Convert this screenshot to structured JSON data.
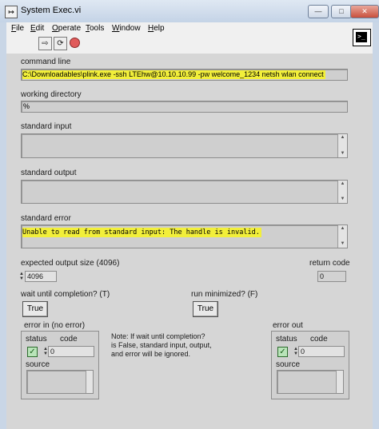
{
  "window": {
    "title": "System Exec.vi",
    "icon_glyph": "↦",
    "controls": [
      "minimize-icon",
      "maximize-icon",
      "close-icon"
    ]
  },
  "menu": {
    "items": [
      {
        "key": "F",
        "rest": "ile"
      },
      {
        "key": "E",
        "rest": "dit"
      },
      {
        "key": "O",
        "rest": "perate"
      },
      {
        "key": "T",
        "rest": "ools"
      },
      {
        "key": "W",
        "rest": "indow"
      },
      {
        "key": "H",
        "rest": "elp"
      }
    ]
  },
  "toolbar": {
    "buttons": [
      "run-arrow-icon",
      "run-continuously-icon",
      "abort-stop-icon"
    ],
    "stop_color": "#e05a5a"
  },
  "vi_icon": {
    "glyph": ">_"
  },
  "fields": {
    "command_line": {
      "label": "command line",
      "value": "C:\\Downloadables\\plink.exe -ssh LTEhw@10.10.10.99 -pw welcome_1234 netsh wlan connect"
    },
    "working_directory": {
      "label": "working directory",
      "value": "%"
    },
    "standard_input": {
      "label": "standard input",
      "value": ""
    },
    "standard_output": {
      "label": "standard output",
      "value": ""
    },
    "standard_error": {
      "label": "standard error",
      "value": "Unable to read from standard input: The handle is invalid."
    },
    "expected_output_size": {
      "label": "expected output size  (4096)",
      "value": "4096"
    },
    "return_code": {
      "label": "return code",
      "value": "0"
    },
    "wait_until_completion": {
      "label": "wait until completion? (T)",
      "value": "True"
    },
    "run_minimized": {
      "label": "run minimized? (F)",
      "value": "True"
    }
  },
  "error_in": {
    "title": "error in (no error)",
    "status_label": "status",
    "code_label": "code",
    "code_value": "0",
    "status_checked": true,
    "source_label": "source"
  },
  "error_out": {
    "title": "error out",
    "status_label": "status",
    "code_label": "code",
    "code_value": "0",
    "status_checked": true,
    "source_label": "source"
  },
  "note": {
    "lines": [
      "Note:  If wait until completion?",
      "is False, standard input, output,",
      "and error will be ignored."
    ]
  },
  "colors": {
    "highlight": "#f2ef3a",
    "panel": "#d6d6d6"
  }
}
